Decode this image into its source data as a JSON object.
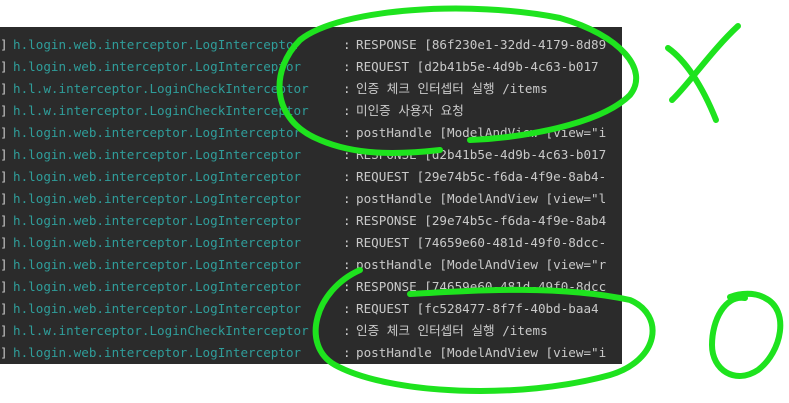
{
  "console": {
    "rows": [
      {
        "bar": "]",
        "logger": "h.login.web.interceptor.LogInterceptor",
        "sep": ":",
        "message": "RESPONSE [86f230e1-32dd-4179-8d89"
      },
      {
        "bar": "]",
        "logger": "h.login.web.interceptor.LogInterceptor",
        "sep": ":",
        "message": "REQUEST [d2b41b5e-4d9b-4c63-b017"
      },
      {
        "bar": "]",
        "logger": "h.l.w.interceptor.LoginCheckInterceptor",
        "sep": ":",
        "message": "인증 체크 인터셉터 실행 /items"
      },
      {
        "bar": "]",
        "logger": "h.l.w.interceptor.LoginCheckInterceptor",
        "sep": ":",
        "message": "미인증 사용자 요청"
      },
      {
        "bar": "]",
        "logger": "h.login.web.interceptor.LogInterceptor",
        "sep": ":",
        "message": "postHandle [ModelAndView [view=\"i"
      },
      {
        "bar": "]",
        "logger": "h.login.web.interceptor.LogInterceptor",
        "sep": ":",
        "message": "RESPONSE [d2b41b5e-4d9b-4c63-b017"
      },
      {
        "bar": "]",
        "logger": "h.login.web.interceptor.LogInterceptor",
        "sep": ":",
        "message": "REQUEST [29e74b5c-f6da-4f9e-8ab4-"
      },
      {
        "bar": "]",
        "logger": "h.login.web.interceptor.LogInterceptor",
        "sep": ":",
        "message": "postHandle [ModelAndView [view=\"l"
      },
      {
        "bar": "]",
        "logger": "h.login.web.interceptor.LogInterceptor",
        "sep": ":",
        "message": "RESPONSE [29e74b5c-f6da-4f9e-8ab4"
      },
      {
        "bar": "]",
        "logger": "h.login.web.interceptor.LogInterceptor",
        "sep": ":",
        "message": "REQUEST [74659e60-481d-49f0-8dcc-"
      },
      {
        "bar": "]",
        "logger": "h.login.web.interceptor.LogInterceptor",
        "sep": ":",
        "message": "postHandle [ModelAndView [view=\"r"
      },
      {
        "bar": "]",
        "logger": "h.login.web.interceptor.LogInterceptor",
        "sep": ":",
        "message": "RESPONSE [74659e60-481d-49f0-8dcc"
      },
      {
        "bar": "]",
        "logger": "h.login.web.interceptor.LogInterceptor",
        "sep": ":",
        "message": "REQUEST [fc528477-8f7f-40bd-baa4"
      },
      {
        "bar": "]",
        "logger": "h.l.w.interceptor.LoginCheckInterceptor",
        "sep": ":",
        "message": "인증 체크 인터셉터 실행 /items"
      },
      {
        "bar": "]",
        "logger": "h.login.web.interceptor.LogInterceptor",
        "sep": ":",
        "message": "postHandle [ModelAndView [view=\"i"
      }
    ]
  },
  "colors": {
    "console_background": "#2b2b2b",
    "logger_text": "#2f9d9a",
    "message_text": "#c9c9c9",
    "annotation": "#1ee31e"
  },
  "annotations": [
    {
      "icon": "x-mark-icon"
    },
    {
      "icon": "o-mark-icon"
    }
  ]
}
